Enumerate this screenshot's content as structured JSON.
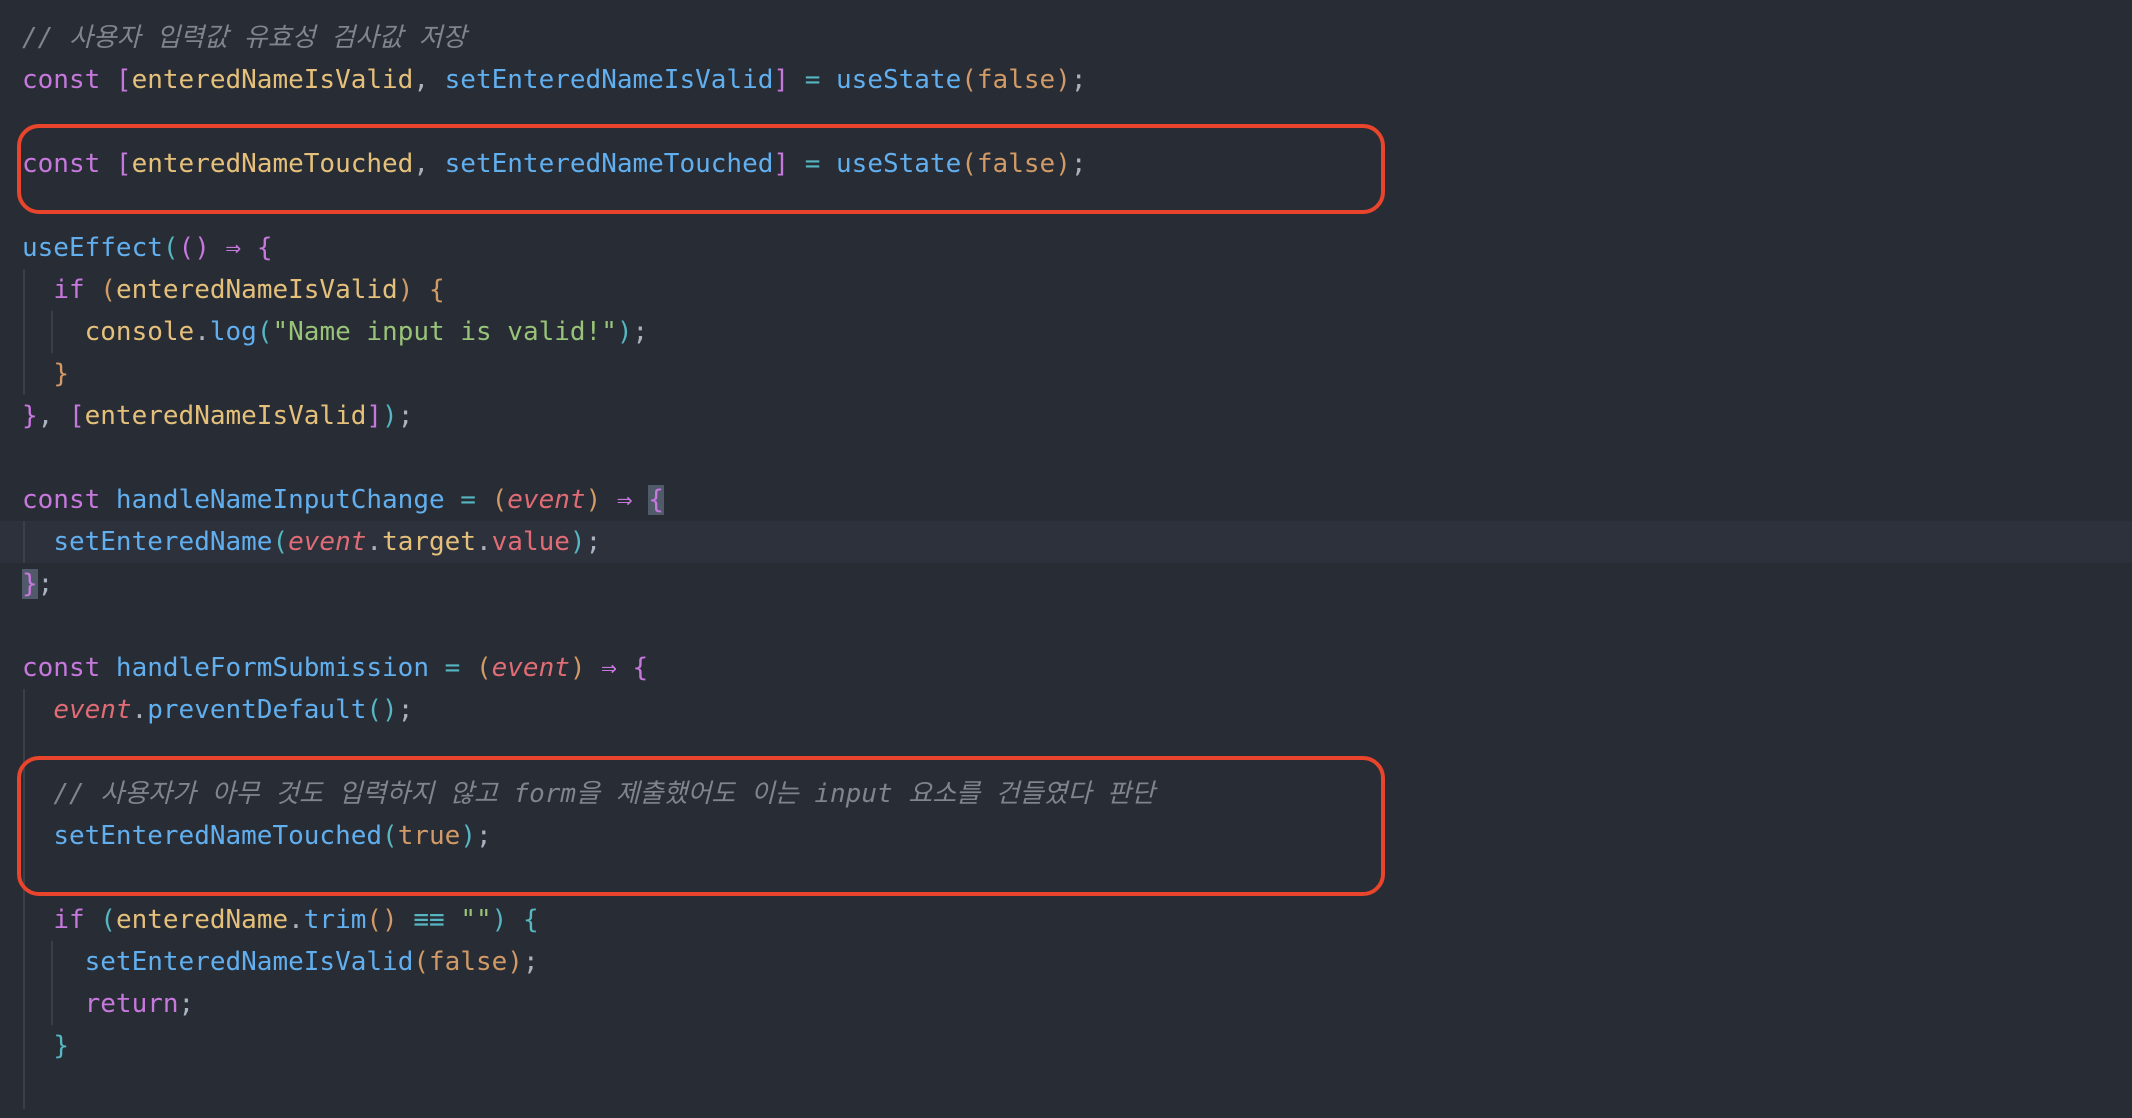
{
  "lines": [
    [
      {
        "t": "// 사용자 입력값 유효성 검사값 저장",
        "c": "comment"
      }
    ],
    [
      {
        "t": "const ",
        "c": "kw"
      },
      {
        "t": "[",
        "c": "brk-p"
      },
      {
        "t": "enteredNameIsValid",
        "c": "var"
      },
      {
        "t": ", ",
        "c": "punc"
      },
      {
        "t": "setEnteredNameIsValid",
        "c": "fn"
      },
      {
        "t": "]",
        "c": "brk-p"
      },
      {
        "t": " = ",
        "c": "op"
      },
      {
        "t": "useState",
        "c": "fn"
      },
      {
        "t": "(",
        "c": "brk-y"
      },
      {
        "t": "false",
        "c": "bool"
      },
      {
        "t": ")",
        "c": "brk-y"
      },
      {
        "t": ";",
        "c": "punc"
      }
    ],
    [],
    [
      {
        "t": "const ",
        "c": "kw"
      },
      {
        "t": "[",
        "c": "brk-p"
      },
      {
        "t": "enteredNameTouched",
        "c": "var"
      },
      {
        "t": ", ",
        "c": "punc"
      },
      {
        "t": "setEnteredNameTouched",
        "c": "fn"
      },
      {
        "t": "]",
        "c": "brk-p"
      },
      {
        "t": " = ",
        "c": "op"
      },
      {
        "t": "useState",
        "c": "fn"
      },
      {
        "t": "(",
        "c": "brk-y"
      },
      {
        "t": "false",
        "c": "bool"
      },
      {
        "t": ")",
        "c": "brk-y"
      },
      {
        "t": ";",
        "c": "punc"
      }
    ],
    [],
    [
      {
        "t": "useEffect",
        "c": "fn"
      },
      {
        "t": "(",
        "c": "brk-b"
      },
      {
        "t": "()",
        "c": "brk-p"
      },
      {
        "t": " ⇒ ",
        "c": "kw"
      },
      {
        "t": "{",
        "c": "brk-p"
      }
    ],
    [
      {
        "t": "  ",
        "c": "punc"
      },
      {
        "t": "if ",
        "c": "kw"
      },
      {
        "t": "(",
        "c": "brk-y"
      },
      {
        "t": "enteredNameIsValid",
        "c": "var"
      },
      {
        "t": ") {",
        "c": "brk-y"
      }
    ],
    [
      {
        "t": "    ",
        "c": "punc"
      },
      {
        "t": "console",
        "c": "obj"
      },
      {
        "t": ".",
        "c": "punc"
      },
      {
        "t": "log",
        "c": "fn"
      },
      {
        "t": "(",
        "c": "brk-b"
      },
      {
        "t": "\"Name input is valid!\"",
        "c": "str"
      },
      {
        "t": ")",
        "c": "brk-b"
      },
      {
        "t": ";",
        "c": "punc"
      }
    ],
    [
      {
        "t": "  ",
        "c": "punc"
      },
      {
        "t": "}",
        "c": "brk-y"
      }
    ],
    [
      {
        "t": "}",
        "c": "brk-p"
      },
      {
        "t": ", ",
        "c": "punc"
      },
      {
        "t": "[",
        "c": "brk-p"
      },
      {
        "t": "enteredNameIsValid",
        "c": "var"
      },
      {
        "t": "]",
        "c": "brk-p"
      },
      {
        "t": ")",
        "c": "brk-b"
      },
      {
        "t": ";",
        "c": "punc"
      }
    ],
    [],
    [
      {
        "t": "const ",
        "c": "kw"
      },
      {
        "t": "handleNameInputChange",
        "c": "fn"
      },
      {
        "t": " = ",
        "c": "op"
      },
      {
        "t": "(",
        "c": "brk-y"
      },
      {
        "t": "event",
        "c": "param"
      },
      {
        "t": ")",
        "c": "brk-y"
      },
      {
        "t": " ⇒ ",
        "c": "kw"
      },
      {
        "t": "{",
        "c": "brk-p match"
      }
    ],
    [
      {
        "t": "  ",
        "c": "punc"
      },
      {
        "t": "setEnteredName",
        "c": "fn"
      },
      {
        "t": "(",
        "c": "brk-b"
      },
      {
        "t": "event",
        "c": "param"
      },
      {
        "t": ".",
        "c": "punc"
      },
      {
        "t": "target",
        "c": "obj"
      },
      {
        "t": ".",
        "c": "punc"
      },
      {
        "t": "value",
        "c": "prop"
      },
      {
        "t": ")",
        "c": "brk-b"
      },
      {
        "t": ";",
        "c": "punc"
      }
    ],
    [
      {
        "t": "}",
        "c": "brk-p match"
      },
      {
        "t": ";",
        "c": "punc"
      }
    ],
    [],
    [
      {
        "t": "const ",
        "c": "kw"
      },
      {
        "t": "handleFormSubmission",
        "c": "fn"
      },
      {
        "t": " = ",
        "c": "op"
      },
      {
        "t": "(",
        "c": "brk-y"
      },
      {
        "t": "event",
        "c": "param"
      },
      {
        "t": ")",
        "c": "brk-y"
      },
      {
        "t": " ⇒ ",
        "c": "kw"
      },
      {
        "t": "{",
        "c": "brk-p"
      }
    ],
    [
      {
        "t": "  ",
        "c": "punc"
      },
      {
        "t": "event",
        "c": "param"
      },
      {
        "t": ".",
        "c": "punc"
      },
      {
        "t": "preventDefault",
        "c": "fn"
      },
      {
        "t": "()",
        "c": "brk-b"
      },
      {
        "t": ";",
        "c": "punc"
      }
    ],
    [],
    [
      {
        "t": "  ",
        "c": "punc"
      },
      {
        "t": "// 사용자가 아무 것도 입력하지 않고 form을 제출했어도 이는 input 요소를 건들였다 판단",
        "c": "comment"
      }
    ],
    [
      {
        "t": "  ",
        "c": "punc"
      },
      {
        "t": "setEnteredNameTouched",
        "c": "fn"
      },
      {
        "t": "(",
        "c": "brk-b"
      },
      {
        "t": "true",
        "c": "bool"
      },
      {
        "t": ")",
        "c": "brk-b"
      },
      {
        "t": ";",
        "c": "punc"
      }
    ],
    [],
    [
      {
        "t": "  ",
        "c": "punc"
      },
      {
        "t": "if ",
        "c": "kw"
      },
      {
        "t": "(",
        "c": "brk-b"
      },
      {
        "t": "enteredName",
        "c": "var"
      },
      {
        "t": ".",
        "c": "punc"
      },
      {
        "t": "trim",
        "c": "fn"
      },
      {
        "t": "()",
        "c": "brk-y"
      },
      {
        "t": " ≡≡ ",
        "c": "op"
      },
      {
        "t": "\"\"",
        "c": "str"
      },
      {
        "t": ") {",
        "c": "brk-b"
      }
    ],
    [
      {
        "t": "    ",
        "c": "punc"
      },
      {
        "t": "setEnteredNameIsValid",
        "c": "fn"
      },
      {
        "t": "(",
        "c": "brk-y"
      },
      {
        "t": "false",
        "c": "bool"
      },
      {
        "t": ")",
        "c": "brk-y"
      },
      {
        "t": ";",
        "c": "punc"
      }
    ],
    [
      {
        "t": "    ",
        "c": "punc"
      },
      {
        "t": "return",
        "c": "kw"
      },
      {
        "t": ";",
        "c": "punc"
      }
    ],
    [
      {
        "t": "  ",
        "c": "punc"
      },
      {
        "t": "}",
        "c": "brk-b"
      }
    ],
    []
  ],
  "current_line": 12,
  "colors": {
    "background": "#282c34",
    "highlight_box": "#e8452c"
  }
}
